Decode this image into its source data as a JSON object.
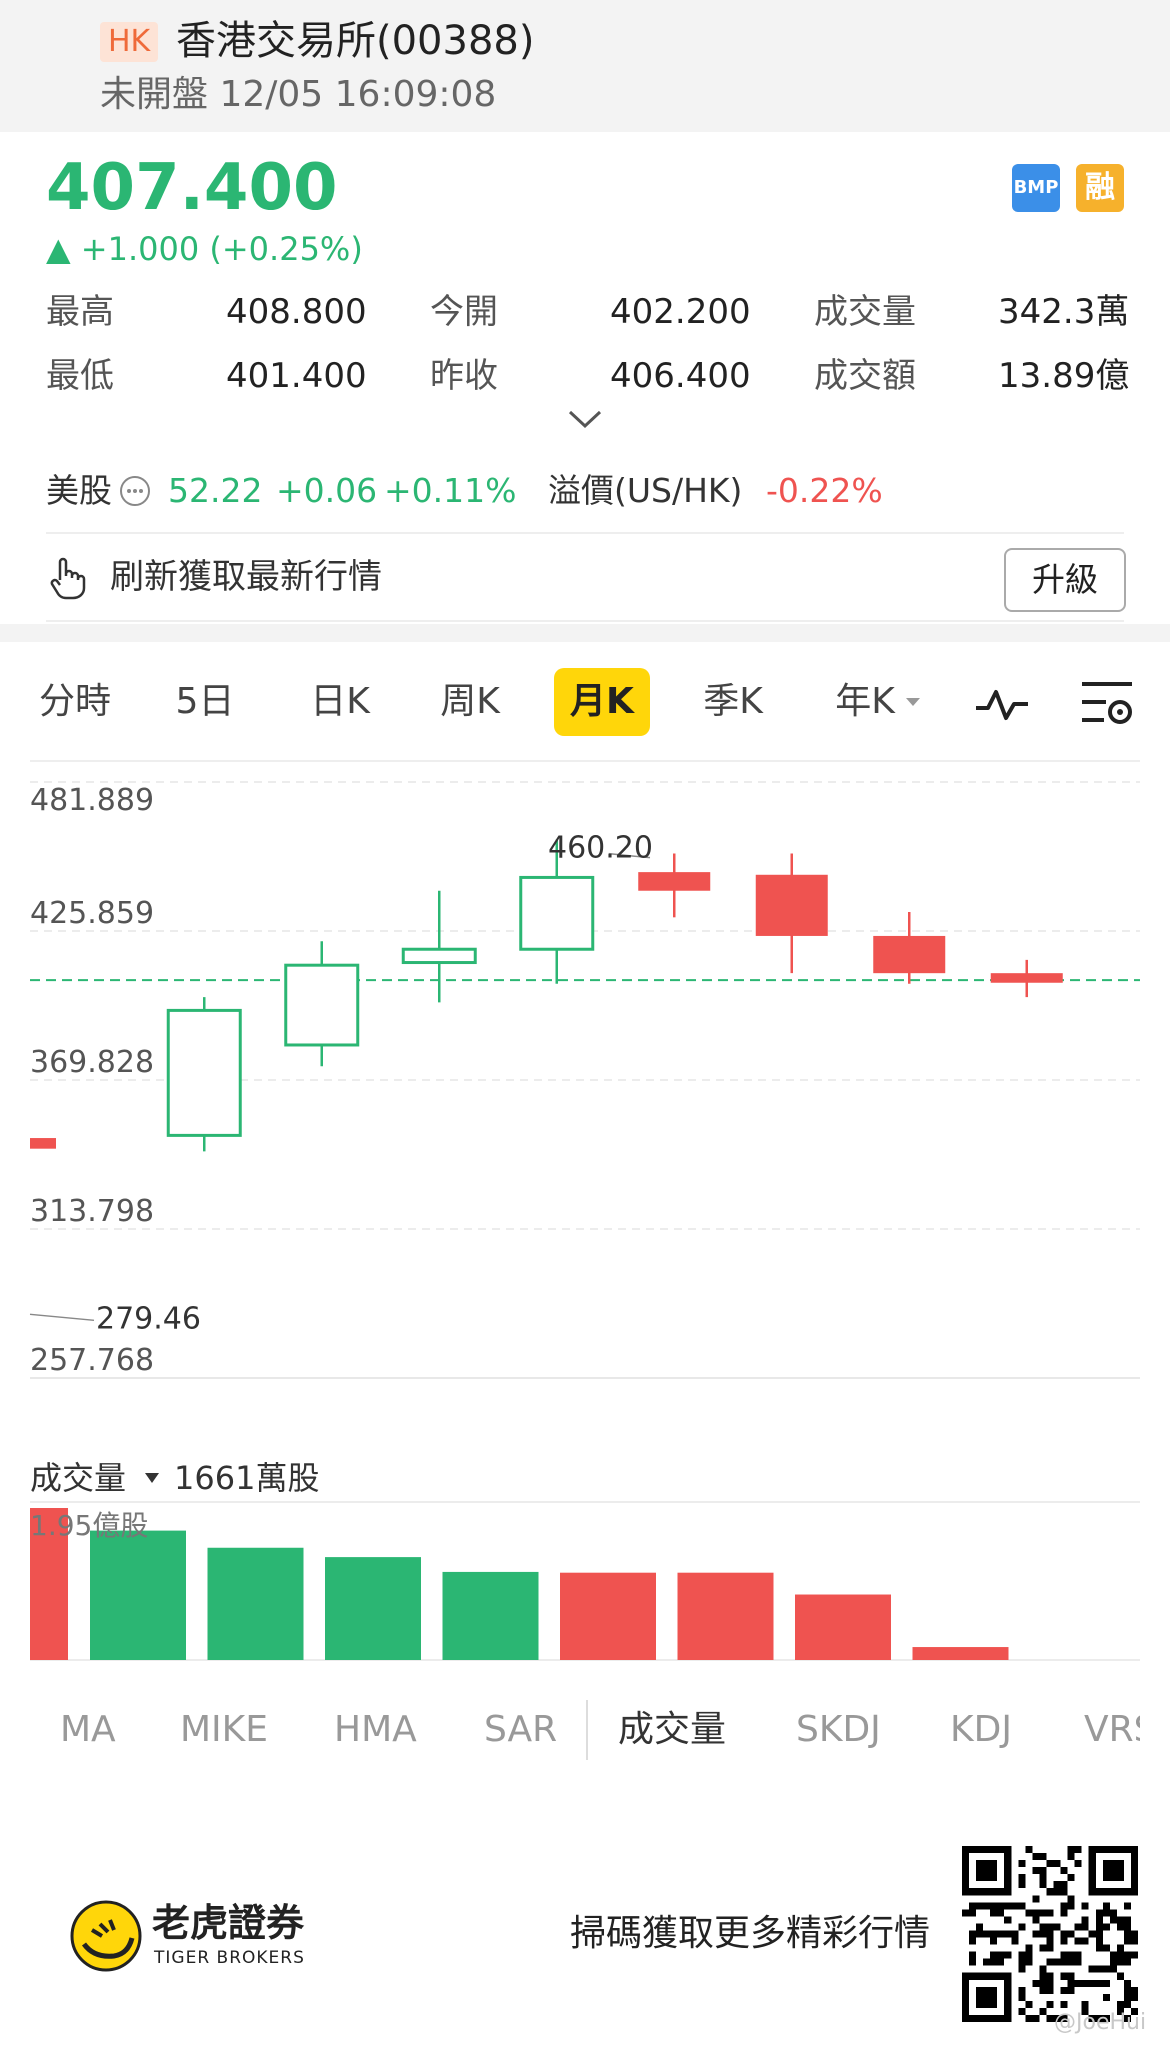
{
  "header": {
    "market_badge": "HK",
    "stock_name": "香港交易所(00388)",
    "status": "未開盤 12/05 16:09:08"
  },
  "quote": {
    "price": "407.400",
    "change": "▲ +1.000 (+0.25%)",
    "badges": {
      "bmp": "BMP",
      "margin": "融"
    },
    "stats": [
      {
        "label": "最高",
        "value": "408.800"
      },
      {
        "label": "今開",
        "value": "402.200"
      },
      {
        "label": "成交量",
        "value": "342.3萬"
      },
      {
        "label": "最低",
        "value": "401.400"
      },
      {
        "label": "昨收",
        "value": "406.400"
      },
      {
        "label": "成交額",
        "value": "13.89億"
      }
    ]
  },
  "us_stock": {
    "label": "美股",
    "price": "52.22",
    "change": "+0.06",
    "pct": "+0.11%",
    "premium_label": "溢價(US/HK)",
    "premium_value": "-0.22%"
  },
  "refresh": {
    "text": "刷新獲取最新行情",
    "button": "升級"
  },
  "tabs": [
    "分時",
    "5日",
    "日K",
    "周K",
    "月K",
    "季K",
    "年K"
  ],
  "active_tab": "月K",
  "indicators": [
    "MA",
    "MIKE",
    "HMA",
    "SAR",
    "成交量",
    "SKDJ",
    "KDJ",
    "VRS"
  ],
  "active_indicator": "成交量",
  "volume": {
    "label": "成交量",
    "current": "1661萬股",
    "max_label": "1.95億股"
  },
  "footer": {
    "broker_name": "老虎證券",
    "broker_en": "TIGER BROKERS",
    "scan_text": "掃碼獲取更多精彩行情",
    "watermark": "@JoeHui"
  },
  "colors": {
    "up": "#2bb673",
    "down": "#ef5350",
    "active_tab": "#ffd60a"
  },
  "chart_data": {
    "type": "candlestick",
    "y_ticks": [
      "481.889",
      "425.859",
      "369.828",
      "313.798",
      "257.768"
    ],
    "ylim": [
      257.768,
      481.889
    ],
    "current_price_line": 407.4,
    "annotations": {
      "high": "460.20",
      "low": "279.46"
    },
    "candles": [
      {
        "open": 348,
        "close": 344,
        "high": 348,
        "low": 344
      },
      {
        "open": 349,
        "close": 396,
        "high": 401,
        "low": 343
      },
      {
        "open": 383,
        "close": 413,
        "high": 422,
        "low": 375
      },
      {
        "open": 414,
        "close": 419,
        "high": 441,
        "low": 399
      },
      {
        "open": 419,
        "close": 446,
        "high": 460.2,
        "low": 406
      },
      {
        "open": 448,
        "close": 441,
        "high": 455,
        "low": 431
      },
      {
        "open": 447,
        "close": 424,
        "high": 455,
        "low": 410
      },
      {
        "open": 424,
        "close": 410,
        "high": 433,
        "low": 406
      },
      {
        "open": 410,
        "close": 406.4,
        "high": 415,
        "low": 401
      }
    ],
    "volumes": [
      {
        "value": 195,
        "dir": "down"
      },
      {
        "value": 166,
        "dir": "up"
      },
      {
        "value": 144,
        "dir": "up"
      },
      {
        "value": 132,
        "dir": "up"
      },
      {
        "value": 113,
        "dir": "up"
      },
      {
        "value": 112,
        "dir": "down"
      },
      {
        "value": 112,
        "dir": "down"
      },
      {
        "value": 84,
        "dir": "down"
      },
      {
        "value": 16.61,
        "dir": "down"
      }
    ],
    "volume_unit": "百萬股",
    "volume_max": 195
  }
}
